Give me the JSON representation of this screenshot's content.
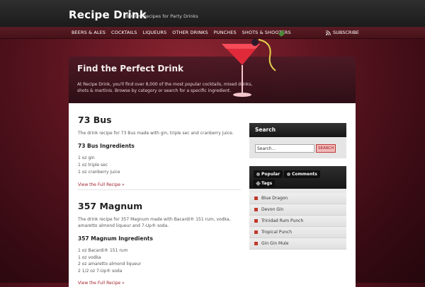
{
  "site": {
    "title": "Recipe Drink",
    "tagline": "8000+ Recipes for Party Drinks"
  },
  "nav": {
    "items": [
      "BEERS & ALES",
      "COCKTAILS",
      "LIQUEURS",
      "OTHER DRINKS",
      "PUNCHES",
      "SHOTS & SHOOTERS"
    ],
    "subscribe": "SUBSCRIBE"
  },
  "hero": {
    "title": "Find the Perfect Drink",
    "text": "At Recipe Drink, you'll find over 8,000 of the most popular cocktails, mixed drinks, shots & martinis. Browse by category or search for a specific ingredient."
  },
  "posts": [
    {
      "title": "73 Bus",
      "description": "The drink recipe for 73 Bus made with gin, triple sec and cranberry juice.",
      "ingredients_heading": "73 Bus Ingredients",
      "ingredients": [
        "1 oz gin",
        "1 oz triple sec",
        "1 oz cranberry juice"
      ],
      "link": "View the Full Recipe »"
    },
    {
      "title": "357 Magnum",
      "description": "The drink recipe for 357 Magnum made with Bacardi® 151 rum, vodka, amaretto almond liqueur and 7-Up® soda.",
      "ingredients_heading": "357 Magnum Ingredients",
      "ingredients": [
        "1 oz Bacardi® 151 rum",
        "1 oz vodka",
        "2 oz amaretto almond liqueur",
        "2 1/2 oz 7-Up® soda"
      ],
      "link": "View the Full Recipe »"
    }
  ],
  "search_widget": {
    "title": "Search",
    "placeholder": "Search...",
    "button": "SEARCH"
  },
  "tabs_widget": {
    "tabs": [
      "Popular",
      "Comments",
      "Tags"
    ],
    "items": [
      "Blue Dragon",
      "Devon Gin",
      "Trinidad Rum Punch",
      "Tropical Punch",
      "Gin Gin Mule"
    ]
  },
  "colors": {
    "accent": "#a0212d",
    "background": "#5c1520",
    "bullet": "#c0392b"
  }
}
